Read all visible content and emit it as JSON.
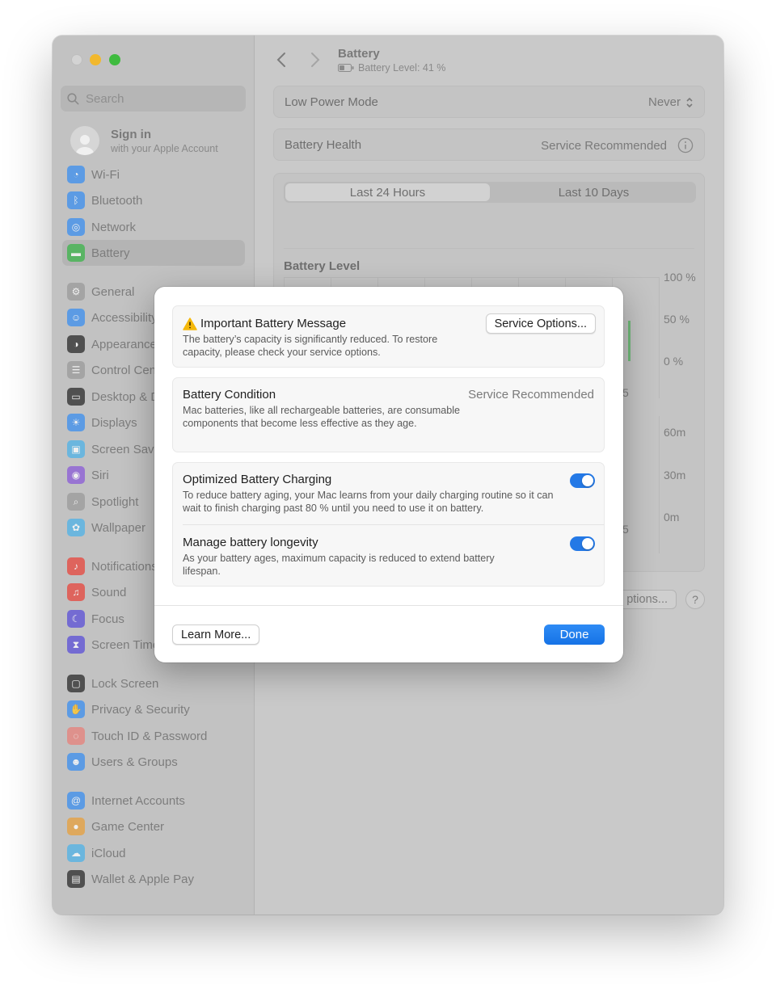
{
  "sidebar": {
    "search_placeholder": "Search",
    "account": {
      "name": "Sign in",
      "subtitle": "with your Apple Account"
    },
    "items": [
      {
        "label": "Wi-Fi",
        "icon": "wifi-icon",
        "color": "#3a8ff0"
      },
      {
        "label": "Bluetooth",
        "icon": "bluetooth-icon",
        "color": "#3a8ff0"
      },
      {
        "label": "Network",
        "icon": "globe-icon",
        "color": "#3a8ff0"
      },
      {
        "label": "Battery",
        "icon": "battery-icon",
        "color": "#3bb54a",
        "active": true
      },
      {
        "label": "General",
        "icon": "gear-icon",
        "color": "#9b9b9b"
      },
      {
        "label": "Accessibility",
        "icon": "accessibility-icon",
        "color": "#3a8ff0"
      },
      {
        "label": "Appearance",
        "icon": "appearance-icon",
        "color": "#2b2b2b"
      },
      {
        "label": "Control Center",
        "icon": "control-center-icon",
        "color": "#9b9b9b"
      },
      {
        "label": "Desktop & Dock",
        "icon": "dock-icon",
        "color": "#2b2b2b"
      },
      {
        "label": "Displays",
        "icon": "sun-icon",
        "color": "#3a8ff0"
      },
      {
        "label": "Screen Saver",
        "icon": "screen-saver-icon",
        "color": "#4fb3e8"
      },
      {
        "label": "Siri",
        "icon": "siri-icon",
        "color": "#8a5ad8"
      },
      {
        "label": "Spotlight",
        "icon": "magnifier-icon",
        "color": "#9b9b9b"
      },
      {
        "label": "Wallpaper",
        "icon": "flower-icon",
        "color": "#4fb3e8"
      },
      {
        "label": "Notifications",
        "icon": "bell-icon",
        "color": "#e8453c"
      },
      {
        "label": "Sound",
        "icon": "speaker-icon",
        "color": "#e8453c"
      },
      {
        "label": "Focus",
        "icon": "moon-icon",
        "color": "#5b4fd8"
      },
      {
        "label": "Screen Time",
        "icon": "hourglass-icon",
        "color": "#5b4fd8"
      },
      {
        "label": "Lock Screen",
        "icon": "lock-icon",
        "color": "#2b2b2b"
      },
      {
        "label": "Privacy & Security",
        "icon": "hand-icon",
        "color": "#3a8ff0"
      },
      {
        "label": "Touch ID & Password",
        "icon": "fingerprint-icon",
        "color": "#e8817a"
      },
      {
        "label": "Users & Groups",
        "icon": "users-icon",
        "color": "#3a8ff0"
      },
      {
        "label": "Internet Accounts",
        "icon": "at-icon",
        "color": "#3a8ff0"
      },
      {
        "label": "Game Center",
        "icon": "game-center-icon",
        "color": "#e8a03c"
      },
      {
        "label": "iCloud",
        "icon": "cloud-icon",
        "color": "#4fb3e8"
      },
      {
        "label": "Wallet & Apple Pay",
        "icon": "wallet-icon",
        "color": "#2b2b2b"
      }
    ]
  },
  "header": {
    "title": "Battery",
    "subtitle": "Battery Level: 41 %"
  },
  "settings": {
    "low_power_label": "Low Power Mode",
    "low_power_value": "Never",
    "health_label": "Battery Health",
    "health_value": "Service Recommended"
  },
  "usage": {
    "tabs": [
      "Last 24 Hours",
      "Last 10 Days"
    ],
    "battery_level_title": "Battery Level",
    "level_ticks": [
      "100 %",
      "50 %",
      "0 %"
    ],
    "time_ticks": [
      "60m",
      "30m",
      "0m"
    ],
    "partial_label_1": "5",
    "partial_label_2": "5"
  },
  "content_buttons": {
    "options_label": "ptions...",
    "help_label": "?"
  },
  "dialog": {
    "message_title": "Important Battery Message",
    "message_desc": "The battery’s capacity is significantly reduced. To restore capacity, please check your service options.",
    "service_button": "Service Options...",
    "condition_title": "Battery Condition",
    "condition_value": "Service Recommended",
    "condition_desc": "Mac batteries, like all rechargeable batteries, are consumable components that become less effective as they age.",
    "optimized_title": "Optimized Battery Charging",
    "optimized_desc": "To reduce battery aging, your Mac learns from your daily charging routine so it can wait to finish charging past 80 % until you need to use it on battery.",
    "optimized_on": true,
    "longevity_title": "Manage battery longevity",
    "longevity_desc": "As your battery ages, maximum capacity is reduced to extend battery lifespan.",
    "longevity_on": true,
    "learn_more": "Learn More...",
    "done": "Done"
  },
  "colors": {
    "accent": "#1673e6",
    "warning": "#f5b80a",
    "battery_bar": "#3bb54a"
  }
}
